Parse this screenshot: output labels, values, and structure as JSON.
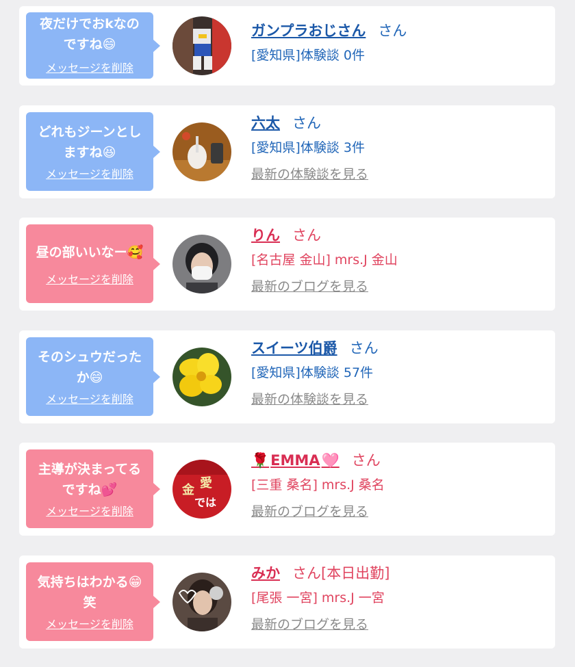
{
  "delete_label": "メッセージを削除",
  "san": "さん",
  "cards": [
    {
      "theme": "blue",
      "message_lines": [
        "夜だけでおkなの",
        "ですね😄"
      ],
      "name": "ガンプラおじさん",
      "suffix": "さん",
      "meta": "[愛知県]体験談 0件",
      "latest": ""
    },
    {
      "theme": "blue",
      "message_lines": [
        "どれもジーンとし",
        "ますね😆"
      ],
      "name": "六太",
      "suffix": "さん",
      "meta": "[愛知県]体験談 3件",
      "latest": "最新の体験談を見る"
    },
    {
      "theme": "pink",
      "message_lines": [
        "昼の部いいなー🥰"
      ],
      "name": "りん",
      "suffix": "さん",
      "meta": "[名古屋 金山] mrs.J 金山",
      "latest": "最新のブログを見る"
    },
    {
      "theme": "blue",
      "message_lines": [
        "そのシュウだった",
        "か😄"
      ],
      "name": "スイーツ伯爵",
      "suffix": "さん",
      "meta": "[愛知県]体験談 57件",
      "latest": "最新の体験談を見る"
    },
    {
      "theme": "pink",
      "message_lines": [
        "主導が決まってる",
        "ですね💕"
      ],
      "name_prefix_icon": "rose-emoji",
      "name": "EMMA",
      "name_suffix_icon": "pink-heart-emoji",
      "suffix": "さん",
      "meta": "[三重 桑名] mrs.J 桑名",
      "latest": "最新のブログを見る"
    },
    {
      "theme": "pink",
      "message_lines": [
        "気持ちはわかる😁",
        "笑"
      ],
      "name": "みか",
      "suffix": "さん[本日出勤]",
      "meta": "[尾張 一宮] mrs.J 一宮",
      "latest": "最新のブログを見る"
    }
  ],
  "colors": {
    "blue_bubble": "#8cb6f6",
    "pink_bubble": "#f7899c",
    "blue_text": "#2166b8",
    "pink_text": "#e0445f",
    "muted_link": "#8a8a8a",
    "page_bg": "#efeff1"
  }
}
